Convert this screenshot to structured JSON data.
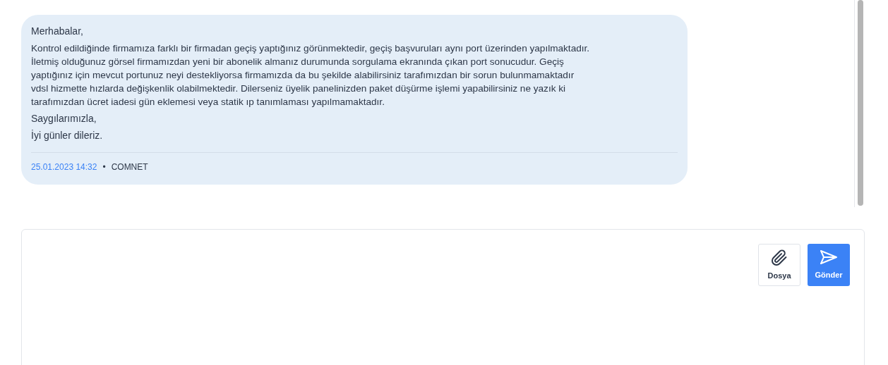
{
  "message": {
    "greeting": "Merhabalar,",
    "body": "Kontrol edildiğinde firmamıza farklı bir firmadan geçiş yaptığınız görünmektedir, geçiş başvuruları aynı port üzerinden yapılmaktadır.\nİletmiş olduğunuz görsel firmamızdan yeni bir abonelik almanız durumunda sorgulama ekranında çıkan port sonucudur. Geçiş\nyaptığınız için mevcut portunuz neyi destekliyorsa firmamızda da bu şekilde alabilirsiniz tarafımızdan bir sorun bulunmamaktadır\nvdsl hizmette hızlarda değişkenlik olabilmektedir. Dilerseniz üyelik panelinizden paket düşürme işlemi yapabilirsiniz ne yazık ki\ntarafımızdan ücret iadesi gün eklemesi veya statik ıp tanımlaması yapılmamaktadır.",
    "closing": "Saygılarımızla,",
    "signoff": "İyi günler dileriz.",
    "timestamp": "25.01.2023 14:32",
    "separator": "•",
    "author": "COMNET"
  },
  "composer": {
    "buttons": [
      {
        "kind": "attach",
        "label": "Dosya"
      },
      {
        "kind": "send",
        "label": "Gönder"
      }
    ]
  }
}
